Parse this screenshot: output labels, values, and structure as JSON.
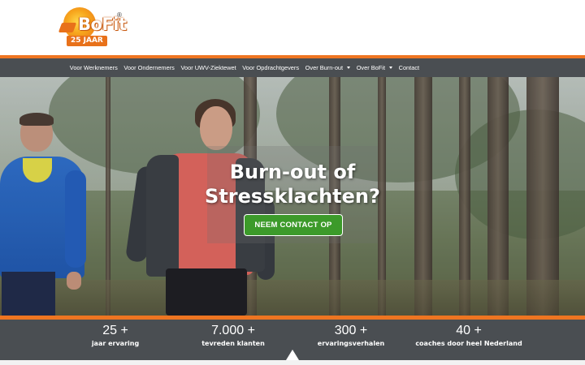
{
  "logo": {
    "brand": "BoFit",
    "registered": "®",
    "anniversary": "25 JAAR"
  },
  "nav": {
    "items": [
      {
        "label": "Voor Werknemers"
      },
      {
        "label": "Voor Ondernemers"
      },
      {
        "label": "Voor UWV-Ziektewet"
      },
      {
        "label": "Voor Opdrachtgevers"
      },
      {
        "label": "Over Burn-out"
      },
      {
        "label": "Over BoFit"
      },
      {
        "label": "Contact"
      }
    ]
  },
  "hero": {
    "title_line1": "Burn-out of",
    "title_line2": "Stressklachten?",
    "cta_label": "NEEM CONTACT OP"
  },
  "stats": [
    {
      "value": "25 +",
      "label": "jaar ervaring"
    },
    {
      "value": "7.000 +",
      "label": "tevreden klanten"
    },
    {
      "value": "300 +",
      "label": "ervaringsverhalen"
    },
    {
      "value": "40 +",
      "label": "coaches door heel Nederland"
    }
  ],
  "colors": {
    "accent_orange": "#ee7521",
    "bar_gray": "#4a4e52",
    "cta_green": "#3c9a2a"
  }
}
